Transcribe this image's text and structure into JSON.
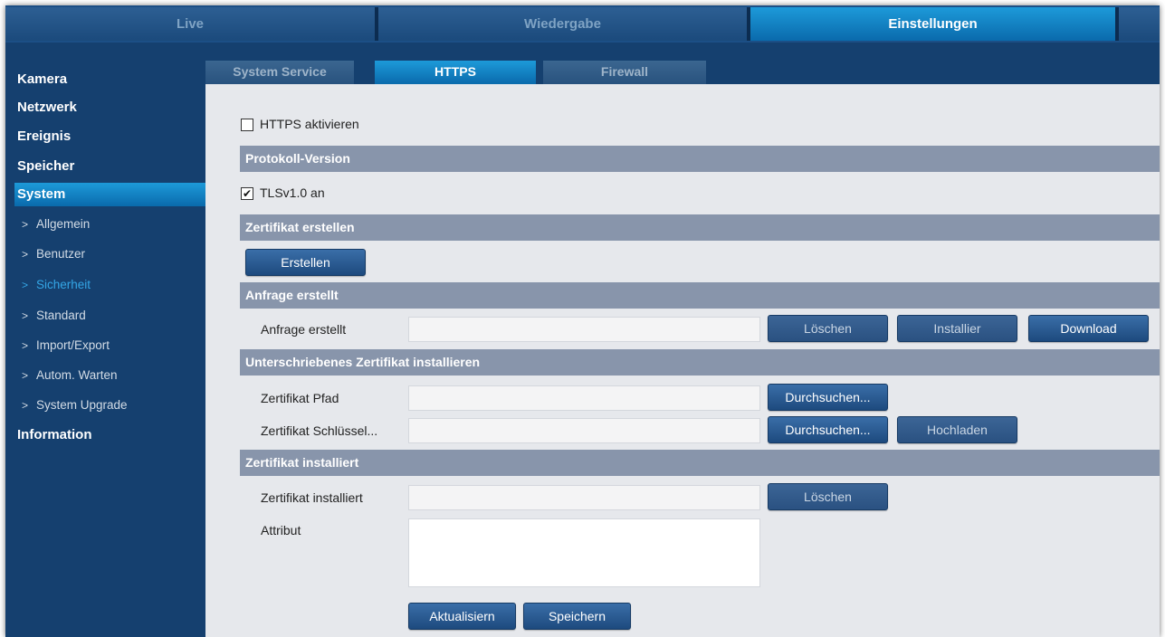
{
  "top_nav": {
    "live": "Live",
    "playback": "Wiedergabe",
    "settings": "Einstellungen"
  },
  "sidebar": {
    "main": [
      {
        "label": "Kamera"
      },
      {
        "label": "Netzwerk"
      },
      {
        "label": "Ereignis"
      },
      {
        "label": "Speicher"
      },
      {
        "label": "System"
      },
      {
        "label": "Information"
      }
    ],
    "sub": [
      {
        "label": "Allgemein"
      },
      {
        "label": "Benutzer"
      },
      {
        "label": "Sicherheit"
      },
      {
        "label": "Standard"
      },
      {
        "label": "Import/Export"
      },
      {
        "label": "Autom. Warten"
      },
      {
        "label": "System Upgrade"
      }
    ],
    "chevron": ">"
  },
  "subtabs": [
    {
      "label": "System Service"
    },
    {
      "label": "HTTPS"
    },
    {
      "label": "Firewall"
    }
  ],
  "https": {
    "enable_label": "HTTPS aktivieren",
    "enable_checked": false,
    "protocol_section": "Protokoll-Version",
    "tls_label": "TLSv1.0 an",
    "tls_checked": true,
    "tls_check_glyph": "✔",
    "create_cert_section": "Zertifikat erstellen",
    "create_button": "Erstellen",
    "request_section": "Anfrage erstellt",
    "request_label": "Anfrage erstellt",
    "request_value": "",
    "delete_button": "Löschen",
    "install_button": "Installier",
    "download_button": "Download",
    "signed_section": "Unterschriebenes Zertifikat installieren",
    "cert_path_label": "Zertifikat Pfad",
    "cert_path_value": "",
    "browse_button": "Durchsuchen...",
    "cert_key_label": "Zertifikat Schlüssel...",
    "cert_key_value": "",
    "upload_button": "Hochladen",
    "installed_section": "Zertifikat installiert",
    "installed_label": "Zertifikat installiert",
    "installed_value": "",
    "attribute_label": "Attribut",
    "attribute_value": "",
    "refresh_button": "Aktualisiern",
    "save_button": "Speichern"
  },
  "colors": {
    "frame_bg": "#15406f",
    "active_tab": "#0a6aac",
    "active_sub_text": "#34a6e6",
    "section_bar": "#8895ab",
    "panel_bg": "#e6e8ec"
  }
}
